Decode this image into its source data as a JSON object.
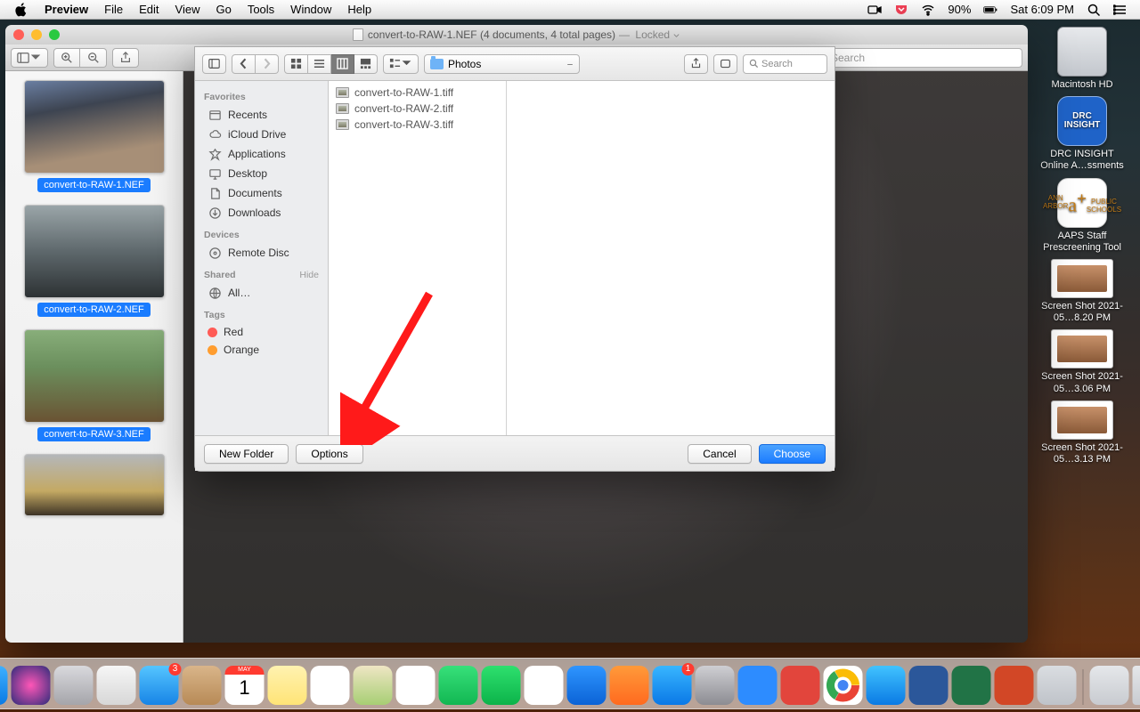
{
  "menubar": {
    "app": "Preview",
    "items": [
      "File",
      "Edit",
      "View",
      "Go",
      "Tools",
      "Window",
      "Help"
    ],
    "wifi": "90%",
    "clock": "Sat 6:09 PM"
  },
  "window": {
    "title_file": "convert-to-RAW-1.NEF",
    "title_meta": "(4 documents, 4 total pages)",
    "locked": "Locked",
    "search_placeholder": "Search"
  },
  "thumbs": [
    {
      "label": "convert-to-RAW-1.NEF"
    },
    {
      "label": "convert-to-RAW-2.NEF"
    },
    {
      "label": "convert-to-RAW-3.NEF"
    },
    {
      "label": ""
    }
  ],
  "sheet": {
    "location": "Photos",
    "search_placeholder": "Search",
    "sidebar": {
      "favorites_hdr": "Favorites",
      "favorites": [
        "Recents",
        "iCloud Drive",
        "Applications",
        "Desktop",
        "Documents",
        "Downloads"
      ],
      "devices_hdr": "Devices",
      "devices": [
        "Remote Disc"
      ],
      "shared_hdr": "Shared",
      "shared_hide": "Hide",
      "shared": [
        "All…"
      ],
      "tags_hdr": "Tags",
      "tags": [
        {
          "name": "Red",
          "color": "red"
        },
        {
          "name": "Orange",
          "color": "orange"
        }
      ]
    },
    "files": [
      "convert-to-RAW-1.tiff",
      "convert-to-RAW-2.tiff",
      "convert-to-RAW-3.tiff"
    ],
    "buttons": {
      "new_folder": "New Folder",
      "options": "Options",
      "cancel": "Cancel",
      "choose": "Choose"
    }
  },
  "desktop_icons": [
    {
      "kind": "hd",
      "label": "Macintosh HD"
    },
    {
      "kind": "drc",
      "label": "DRC INSIGHT Online A…ssments"
    },
    {
      "kind": "aaps",
      "label": "AAPS Staff Prescreening Tool"
    },
    {
      "kind": "shot",
      "label": "Screen Shot 2021-05…8.20 PM"
    },
    {
      "kind": "shot",
      "label": "Screen Shot 2021-05…3.06 PM"
    },
    {
      "kind": "shot",
      "label": "Screen Shot 2021-05…3.13 PM"
    }
  ],
  "dock": {
    "apps": [
      {
        "name": "finder",
        "bg": "linear-gradient(#3fb0ff,#0a7ae4)"
      },
      {
        "name": "siri",
        "bg": "radial-gradient(circle at 50% 50%,#ff56b7,#2c2c7a)"
      },
      {
        "name": "launchpad",
        "bg": "linear-gradient(#d9d9dd,#a5a5aa)"
      },
      {
        "name": "safari-alt",
        "bg": "linear-gradient(#f6f6f6,#d7d7d7)"
      },
      {
        "name": "mail",
        "bg": "linear-gradient(#55c5ff,#1784e6)",
        "badge": "3"
      },
      {
        "name": "contacts",
        "bg": "linear-gradient(#d9b58a,#b78a56)"
      },
      {
        "name": "calendar",
        "bg": "#fff"
      },
      {
        "name": "notes",
        "bg": "linear-gradient(#fff2b0,#ffe477)"
      },
      {
        "name": "reminders",
        "bg": "#fff"
      },
      {
        "name": "maps",
        "bg": "linear-gradient(#efe6c4,#a7ce74)"
      },
      {
        "name": "photos",
        "bg": "#fff"
      },
      {
        "name": "messages",
        "bg": "linear-gradient(#37e07a,#12b752)"
      },
      {
        "name": "facetime",
        "bg": "linear-gradient(#2ee06e,#0cb34a)"
      },
      {
        "name": "numbers",
        "bg": "#fff"
      },
      {
        "name": "keynote",
        "bg": "linear-gradient(#2e95ff,#0b63d6)"
      },
      {
        "name": "ibooks",
        "bg": "linear-gradient(#ff9a3a,#ff6a1f)"
      },
      {
        "name": "appstore",
        "bg": "linear-gradient(#38b6ff,#0a78e6)",
        "badge": "1"
      },
      {
        "name": "sysprefs",
        "bg": "linear-gradient(#cfcfd3,#8c8c92)"
      },
      {
        "name": "zoom",
        "bg": "#2d8cff"
      },
      {
        "name": "todo",
        "bg": "#e2453c"
      },
      {
        "name": "chrome",
        "bg": "#fff"
      },
      {
        "name": "safari",
        "bg": "linear-gradient(#41c3ff,#0a7ae4)"
      },
      {
        "name": "word",
        "bg": "#2b579a"
      },
      {
        "name": "excel",
        "bg": "#217346"
      },
      {
        "name": "powerpoint",
        "bg": "#d24726"
      },
      {
        "name": "preview",
        "bg": "linear-gradient(#dadde1,#bfc3c9)"
      }
    ],
    "right": [
      {
        "name": "downloads",
        "bg": "linear-gradient(#e5e7ea,#c8cbd0)"
      },
      {
        "name": "trash",
        "bg": "linear-gradient(#e5e7ea,#c8cbd0)"
      }
    ],
    "cal_month": "MAY",
    "cal_day": "1"
  }
}
